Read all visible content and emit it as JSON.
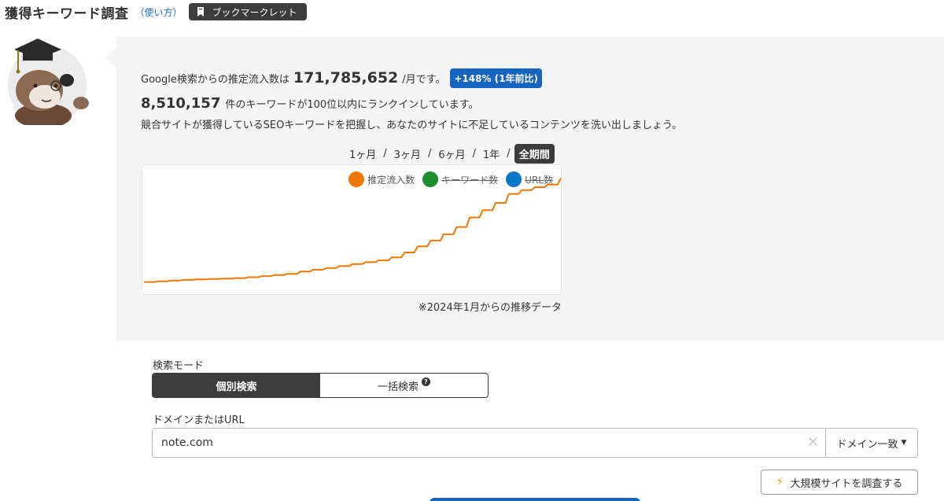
{
  "header": {
    "title": "獲得キーワード調査",
    "howto_label": "（使い方）",
    "bookmarklet_label": "ブックマークレット"
  },
  "summary": {
    "traffic_prefix": "Google検索からの推定流入数は",
    "traffic_value": "171,785,652",
    "traffic_suffix": "/月です。",
    "growth_badge": "+148% (1年前比)",
    "keyword_value": "8,510,157",
    "keyword_text": "件のキーワードが100位以内にランクインしています。",
    "description": "競合サイトが獲得しているSEOキーワードを把握し、あなたのサイトに不足しているコンテンツを洗い出しましょう。"
  },
  "periods": [
    {
      "label": "1ヶ月",
      "active": false
    },
    {
      "label": "3ヶ月",
      "active": false
    },
    {
      "label": "6ヶ月",
      "active": false
    },
    {
      "label": "1年",
      "active": false
    },
    {
      "label": "全期間",
      "active": true
    }
  ],
  "period_separator": "/",
  "chart_data": {
    "type": "line",
    "series": [
      {
        "name": "推定流入数",
        "color": "#f07800",
        "visible": true,
        "values": [
          5,
          5.6,
          6.2,
          6.8,
          7.2,
          7.6,
          8.0,
          8.4,
          9.1,
          10.1,
          11.0,
          12.0,
          14.0,
          15.6,
          17.0,
          18.8,
          20.4,
          22.0,
          23.6,
          26.2,
          30.4,
          35.6,
          40.6,
          46.0,
          52.3,
          60.5,
          66.7,
          73.0,
          80.7,
          84.0,
          86.5,
          88.7,
          94.4
        ]
      },
      {
        "name": "キーワード数",
        "color": "#1e8e2e",
        "visible": false,
        "values": []
      },
      {
        "name": "URL数",
        "color": "#0a78c8",
        "visible": false,
        "values": []
      }
    ],
    "ylim": [
      0,
      100
    ],
    "grid": false,
    "legend_position": "top-right",
    "note": "※2024年1月からの推移データ"
  },
  "search_mode": {
    "label": "検索モード",
    "individual_label": "個別検索",
    "bulk_label": "一括検索",
    "help_glyph": "?"
  },
  "domain_input": {
    "label": "ドメインまたはURL",
    "value": "note.com",
    "clear_glyph": "✕",
    "match_label": "ドメイン一致"
  },
  "large_site_button": {
    "label": "大規模サイトを調査する",
    "icon_glyph": "⚡"
  }
}
